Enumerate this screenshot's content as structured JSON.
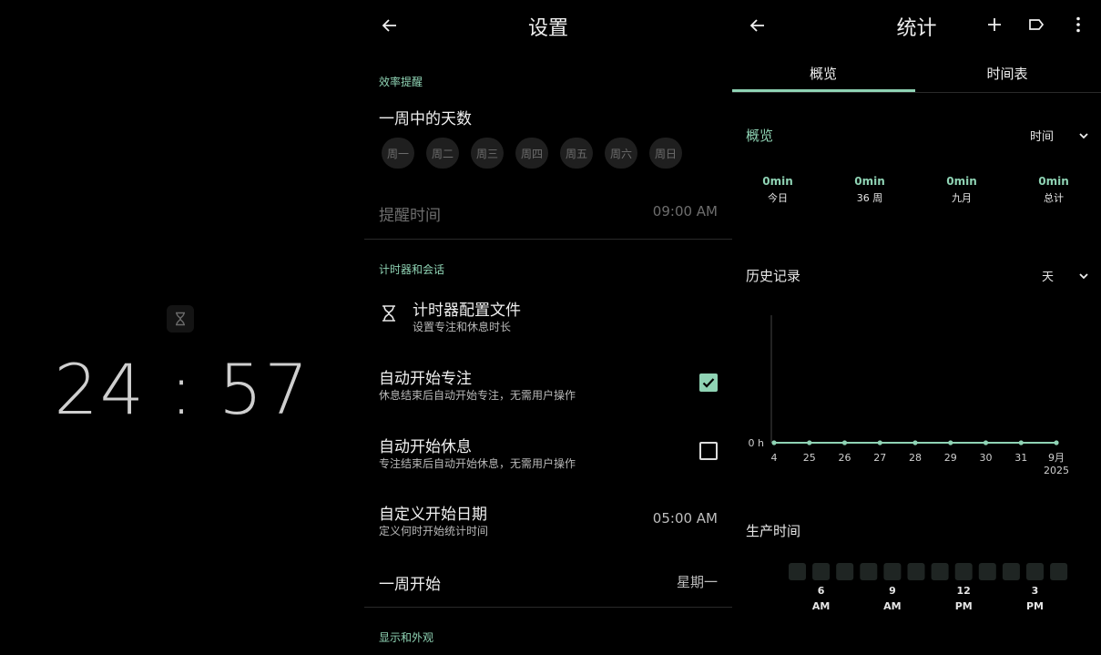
{
  "timer": {
    "time": "24 : 57"
  },
  "settings": {
    "title": "设置",
    "sec_reminder": "效率提醒",
    "days_title": "一周中的天数",
    "days": [
      "周一",
      "周二",
      "周三",
      "周四",
      "周五",
      "周六",
      "周日"
    ],
    "reminder_label": "提醒时间",
    "reminder_value": "09:00 AM",
    "sec_timer": "计时器和会话",
    "profile_title": "计时器配置文件",
    "profile_sub": "设置专注和休息时长",
    "auto_focus_title": "自动开始专注",
    "auto_focus_sub": "休息结束后自动开始专注，无需用户操作",
    "auto_focus_checked": true,
    "auto_break_title": "自动开始休息",
    "auto_break_sub": "专注结束后自动开始休息，无需用户操作",
    "auto_break_checked": false,
    "custom_day_title": "自定义开始日期",
    "custom_day_sub": "定义何时开始统计时间",
    "custom_day_value": "05:00 AM",
    "week_start_title": "一周开始",
    "week_start_value": "星期一",
    "sec_display": "显示和外观"
  },
  "stats": {
    "title": "统计",
    "tabs": [
      "概览",
      "时间表"
    ],
    "overview_title": "概览",
    "overview_dd": "时间",
    "summary": [
      {
        "value": "0min",
        "label": "今日"
      },
      {
        "value": "0min",
        "label": "36 周"
      },
      {
        "value": "0min",
        "label": "九月"
      },
      {
        "value": "0min",
        "label": "总计"
      }
    ],
    "history_title": "历史记录",
    "history_dd": "天",
    "productive_title": "生产时间"
  },
  "chart_data": [
    {
      "type": "line",
      "title": "历史记录",
      "y_tick_labels": [
        "0 h"
      ],
      "categories": [
        "4",
        "25",
        "26",
        "27",
        "28",
        "29",
        "30",
        "31",
        "9月\n2025"
      ],
      "series": [
        {
          "values": [
            0,
            0,
            0,
            0,
            0,
            0,
            0,
            0,
            0
          ]
        }
      ],
      "color": "#8fd3b4"
    },
    {
      "type": "heatmap",
      "title": "生产时间",
      "cells": [
        0,
        0,
        0,
        0,
        0,
        0,
        0,
        0,
        0,
        0,
        0,
        0
      ],
      "tick_labels": [
        {
          "top": "6",
          "bottom": "AM",
          "cell": 1
        },
        {
          "top": "9",
          "bottom": "AM",
          "cell": 4
        },
        {
          "top": "12",
          "bottom": "PM",
          "cell": 7
        },
        {
          "top": "3",
          "bottom": "PM",
          "cell": 10
        }
      ],
      "color": "#1f2523"
    }
  ]
}
